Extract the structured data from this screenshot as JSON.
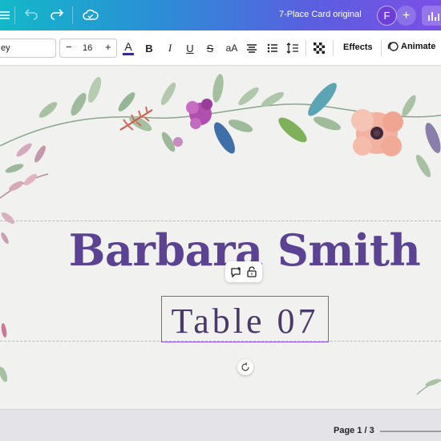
{
  "topbar": {
    "doc_title": "7-Place Card original",
    "avatar_initial": "F",
    "plus": "+"
  },
  "toolbar": {
    "font_name": "ey",
    "font_size": "16",
    "minus": "−",
    "plus": "+",
    "color_letter": "A",
    "bold": "B",
    "italic": "I",
    "underline": "U",
    "strike": "S",
    "case": "aA",
    "effects": "Effects",
    "animate": "Animate",
    "text_color": "#3b2a8c"
  },
  "canvas": {
    "name": "Barbara Smith",
    "table": "Table 07"
  },
  "bottombar": {
    "page_indicator": "Page 1 / 3"
  }
}
